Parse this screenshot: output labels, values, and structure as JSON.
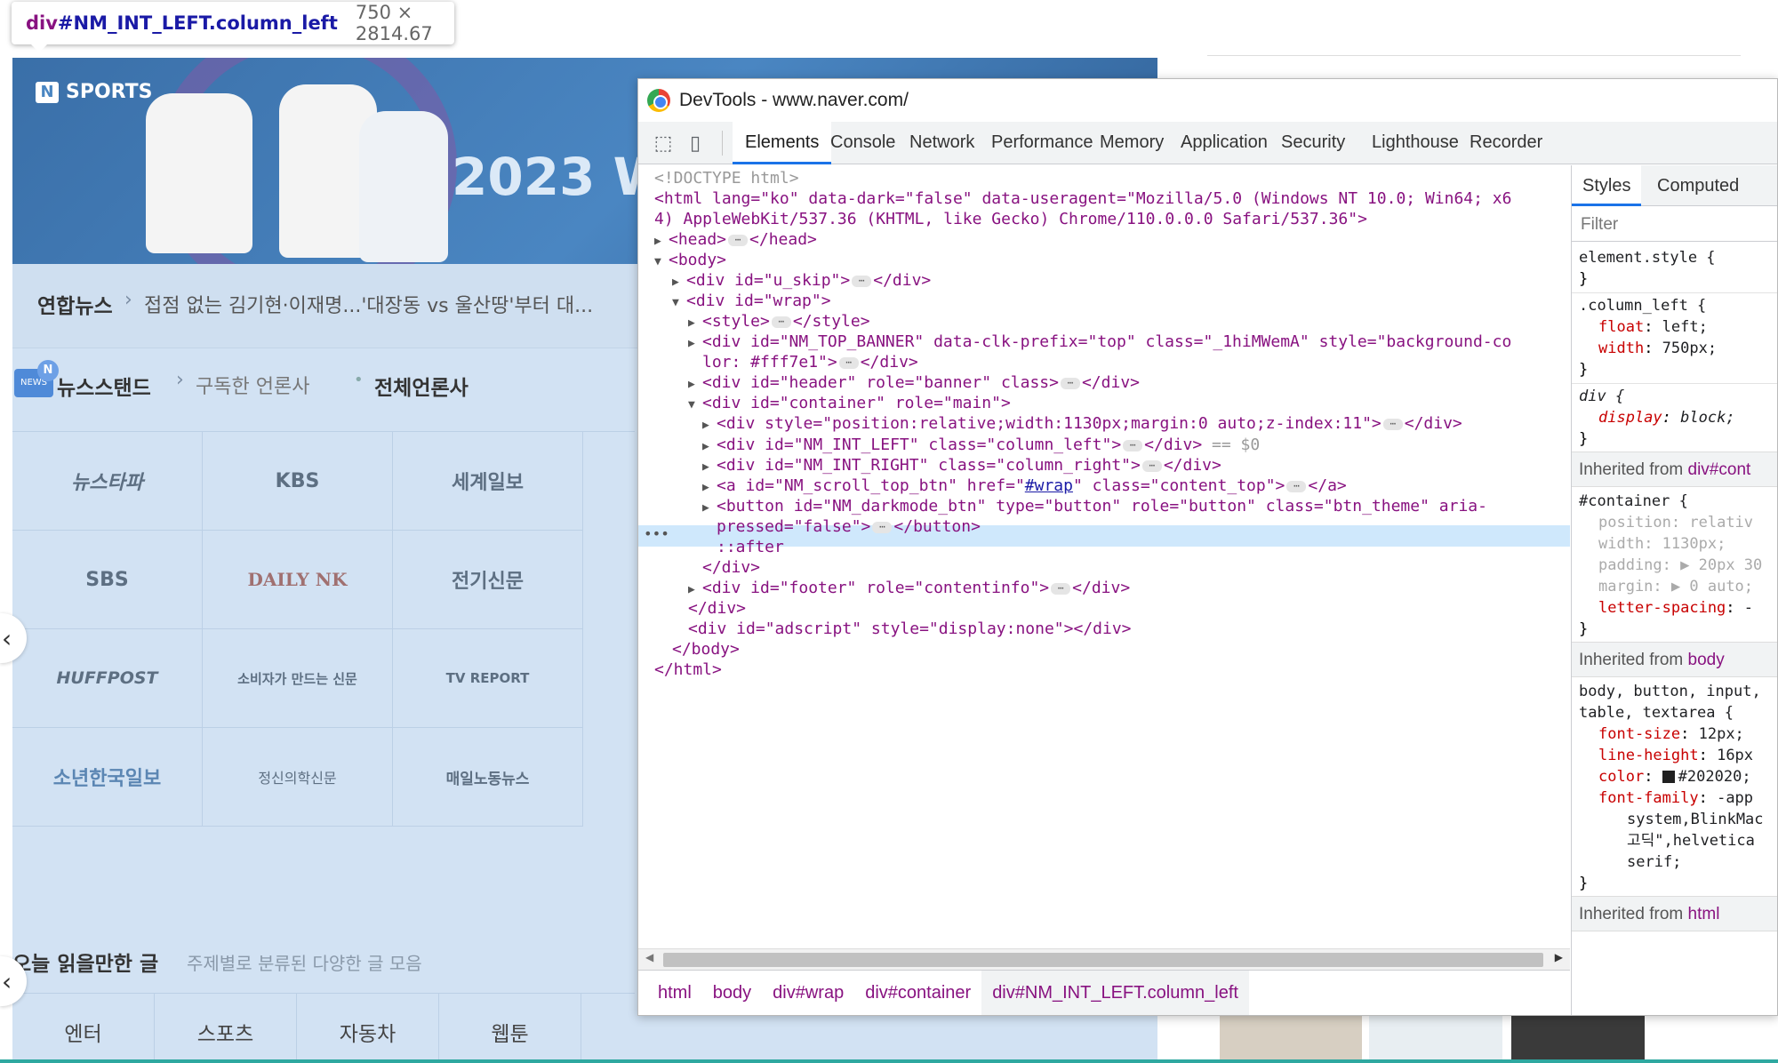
{
  "inspect_tooltip": {
    "selector_tag": "div",
    "selector_id": "#NM_INT_LEFT.column_left",
    "dimensions": "750 × 2814.67"
  },
  "page": {
    "banner_brand": "SPORTS",
    "banner_brand_mark": "N",
    "banner_headline": "2023 W",
    "headline_source": "연합뉴스",
    "headline_text": "접점 없는 김기현·이재명...'대장동 vs 울산땅'부터 대...",
    "newsstand_icon_text": "NEWS",
    "newsstand_icon_badge": "N",
    "newsstand_title": "뉴스스탠드",
    "newsstand_subscribed": "구독한 언론사",
    "newsstand_all": "전체언론사",
    "press": [
      "뉴스타파",
      "KBS",
      "세계일보",
      "SBS",
      "DAILY NK",
      "전기신문",
      "HUFFPOST",
      "소비자가 만드는 신문",
      "TV REPORT",
      "소년한국일보",
      "정신의학신문",
      "매일노동뉴스"
    ],
    "today_title": "오늘 읽을만한 글",
    "today_sub": "주제별로 분류된 다양한 글 모음",
    "today_tabs": [
      "엔터",
      "스포츠",
      "자동차",
      "웹툰"
    ],
    "nav_prev": "‹"
  },
  "devtools": {
    "window_title": "DevTools - www.naver.com/",
    "tabs": [
      "Elements",
      "Console",
      "Network",
      "Performance",
      "Memory",
      "Application",
      "Security",
      "Lighthouse",
      "Recorder"
    ],
    "active_tab": "Elements",
    "code": {
      "doctype": "<!DOCTYPE html>",
      "html_open_1": "<html lang=\"ko\" data-dark=\"false\" data-useragent=\"Mozilla/5.0 (Windows NT 10.0; Win64; x6",
      "html_open_2": "4) AppleWebKit/537.36 (KHTML, like Gecko) Chrome/110.0.0.0 Safari/537.36\">",
      "head": "<head>",
      "head_close": "</head>",
      "body": "<body>",
      "u_skip": "<div id=\"u_skip\">",
      "wrap": "<div id=\"wrap\">",
      "style": "<style>",
      "style_close": "</style>",
      "top_banner_1": "<div id=\"NM_TOP_BANNER\" data-clk-prefix=\"top\" class=\"_1hiMWemA\" style=\"background-co",
      "top_banner_2": "lor: #fff7e1\">",
      "header": "<div id=\"header\" role=\"banner\" class>",
      "container": "<div id=\"container\" role=\"main\">",
      "relative_div": "<div style=\"position:relative;width:1130px;margin:0 auto;z-index:11\">",
      "int_left": "<div id=\"NM_INT_LEFT\" class=\"column_left\">",
      "int_left_tail": " == $0",
      "int_right": "<div id=\"NM_INT_RIGHT\" class=\"column_right\">",
      "scroll_btn_a": "<a id=\"NM_scroll_top_btn\" href=\"",
      "scroll_btn_href": "#wrap",
      "scroll_btn_b": "\" class=\"content_top\">",
      "darkmode_1": "<button id=\"NM_darkmode_btn\" type=\"button\" role=\"button\" class=\"btn_theme\" aria-",
      "darkmode_2": "pressed=\"false\">",
      "after": "::after",
      "div_close": "</div>",
      "footer": "<div id=\"footer\" role=\"contentinfo\">",
      "adscript": "<div id=\"adscript\" style=\"display:none\"></div>",
      "body_close": "</body>",
      "html_close": "</html>",
      "a_close": "</a>",
      "button_close": "</button>",
      "ellipsis": "⋯"
    },
    "breadcrumbs": [
      "html",
      "body",
      "div#wrap",
      "div#container",
      "div#NM_INT_LEFT.column_left"
    ],
    "styles_tabs": [
      "Styles",
      "Computed"
    ],
    "filter_placeholder": "Filter",
    "styles": {
      "element_style": "element.style {",
      "close": "}",
      "column_left_sel": ".column_left {",
      "float_prop": "float",
      "float_val": "left;",
      "width_prop": "width",
      "width_val": "750px;",
      "div_sel": "div {",
      "display_prop": "display",
      "display_val": "block;",
      "inh_from": "Inherited from",
      "inh_container": "div#cont",
      "container_sel": "#container {",
      "position_prop": "position",
      "position_val": "relativ",
      "width2_val": "1130px;",
      "padding_prop": "padding",
      "padding_val": "▶ 20px 30",
      "margin_prop": "margin",
      "margin_val": "▶ 0 auto;",
      "ls_prop": "letter-spacing",
      "ls_val": "-",
      "inh_body": "body",
      "body_sel_1": "body, button, input,",
      "body_sel_2": "table, textarea {",
      "fs_prop": "font-size",
      "fs_val": "12px;",
      "lh_prop": "line-height",
      "lh_val": "16px",
      "color_prop": "color",
      "color_val": "#202020;",
      "ff_prop": "font-family",
      "ff_val_1": "-app",
      "ff_val_2": "system,BlinkMac",
      "ff_val_3": "고딕\",helvetica",
      "ff_val_4": "serif;",
      "inh_html": "html"
    }
  },
  "colors": {
    "selection": "#cfe8fc",
    "tag": "#881280",
    "attr": "#994500",
    "value": "#1a1aa6",
    "accent": "#1a73e8",
    "highlight_overlay": "#d2e2f3"
  }
}
